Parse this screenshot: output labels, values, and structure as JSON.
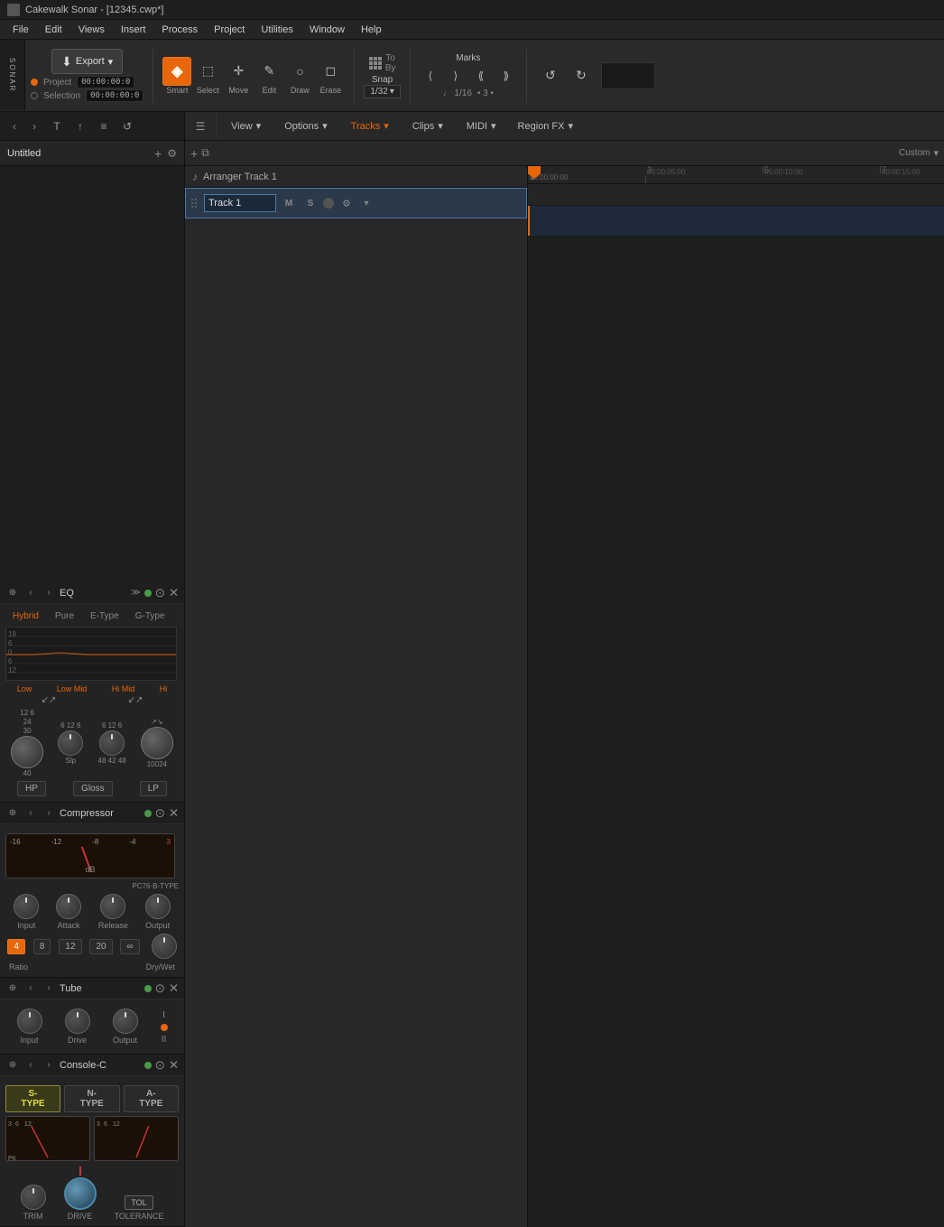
{
  "app": {
    "title": "Cakewalk Sonar - [12345.cwp*]",
    "logo": "Sonar"
  },
  "menu": {
    "items": [
      "File",
      "Edit",
      "Views",
      "Insert",
      "Process",
      "Project",
      "Utilities",
      "Window",
      "Help"
    ]
  },
  "toolbar": {
    "export_label": "Export",
    "tools": [
      {
        "id": "smart",
        "label": "Smart",
        "icon": "◈",
        "active": true
      },
      {
        "id": "select",
        "label": "Select",
        "icon": "⬚",
        "active": false
      },
      {
        "id": "move",
        "label": "Move",
        "icon": "✛",
        "active": false
      },
      {
        "id": "edit",
        "label": "Edit",
        "icon": "✎",
        "active": false
      },
      {
        "id": "draw",
        "label": "Draw",
        "icon": "○",
        "active": false
      },
      {
        "id": "erase",
        "label": "Erase",
        "icon": "◻",
        "active": false
      }
    ],
    "snap_label": "Snap",
    "snap_value": "1/32",
    "marks_label": "Marks",
    "time_label": "1/16",
    "time_value": "3",
    "project_time": "00:00:00:0",
    "selection_time": "00:00:00:0"
  },
  "secondary_toolbar": {
    "nav_left": "‹",
    "nav_right": "›",
    "icons": [
      "≡",
      "T",
      "↑",
      "≡",
      "↺"
    ]
  },
  "left_panel": {
    "title": "Untitled",
    "add_icon": "+",
    "settings_icon": "⚙"
  },
  "tracks_toolbar": {
    "view_label": "View",
    "options_label": "Options",
    "tracks_label": "Tracks",
    "clips_label": "Clips",
    "midi_label": "MIDI",
    "region_fx_label": "Region FX",
    "custom_label": "Custom",
    "add_icon": "+",
    "duplicate_icon": "⧉"
  },
  "arranger": {
    "track_label": "Arranger Track 1"
  },
  "tracks": [
    {
      "id": 1,
      "name": "Track 1",
      "mute": "M",
      "solo": "S",
      "record": "●",
      "selected": true
    }
  ],
  "timeline": {
    "positions": [
      "1",
      "00:00:00:00",
      "3",
      "00:00:05:00",
      "5",
      "00:00:10:00",
      "7",
      "00:00:15:00"
    ],
    "playhead_pos": "0"
  },
  "plugins": {
    "eq": {
      "title": "EQ",
      "tabs": [
        "Hybrid",
        "Pure",
        "E-Type",
        "G-Type"
      ],
      "active_tab": "Hybrid",
      "bands": [
        "Low",
        "Low Mid",
        "Hi Mid",
        "Hi"
      ],
      "buttons": [
        "HP",
        "Gloss",
        "LP"
      ],
      "freq_labels": [
        "40",
        "Slp",
        "",
        "10024"
      ]
    },
    "compressor": {
      "title": "Compressor",
      "type": "PC76-B-TYPE",
      "knobs": [
        "Input",
        "Attack",
        "Release",
        "Output"
      ],
      "ratios": [
        "4",
        "8",
        "12",
        "20",
        "∞"
      ],
      "active_ratio": "4",
      "ratio_label": "Ratio",
      "dry_wet_label": "Dry/Wet"
    },
    "tube": {
      "title": "Tube",
      "knobs": [
        "Input",
        "Drive",
        "Output"
      ],
      "indicators": [
        "·",
        "●",
        "||"
      ]
    },
    "console": {
      "title": "Console-C",
      "types": [
        "S-TYPE",
        "N-TYPE",
        "A-TYPE"
      ],
      "active_type": "S-TYPE",
      "trim_label": "TRIM",
      "drive_label": "DRIVE",
      "tolerance_label": "TOLERANCE",
      "tolerance_btn": "TOL"
    }
  }
}
